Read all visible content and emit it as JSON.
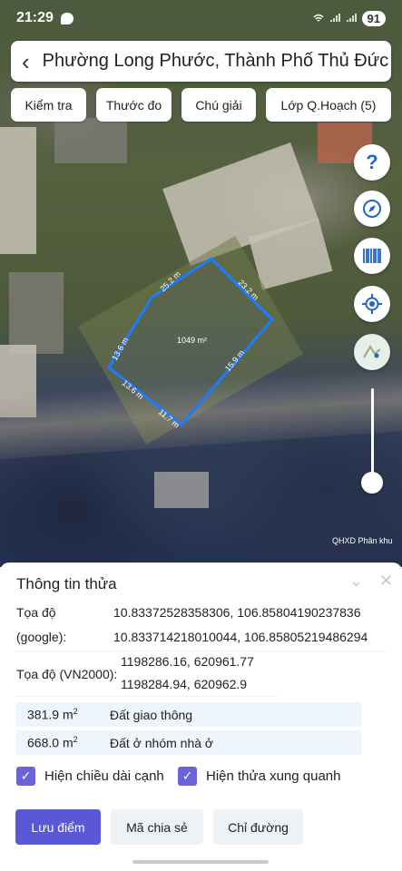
{
  "status_bar": {
    "time": "21:29",
    "battery": "91"
  },
  "search": {
    "back_icon": "chevron-left-icon",
    "title": "Phường Long Phước, Thành Phố Thủ Đức"
  },
  "chips": [
    {
      "label": "Kiểm tra"
    },
    {
      "label": "Thước đo"
    },
    {
      "label": "Chú giải"
    },
    {
      "label": "Lớp Q.Hoạch (5)"
    }
  ],
  "map_tools": [
    {
      "icon": "help-icon",
      "glyph": "?"
    },
    {
      "icon": "compass-icon",
      "glyph": "⊘"
    },
    {
      "icon": "barcode-icon",
      "glyph": "||||"
    },
    {
      "icon": "locate-icon",
      "glyph": "◎"
    },
    {
      "icon": "map-layer-icon",
      "glyph": "◈"
    }
  ],
  "parcel": {
    "area": "1049 m²",
    "edges": [
      "25.2 m",
      "23.2 m",
      "13.6 m",
      "13.6 m",
      "15.9 m",
      "11.7 m"
    ]
  },
  "map_label": "QHXD Phân khu",
  "sheet": {
    "title": "Thông tin thửa",
    "google_label_1": "Tọa độ",
    "google_label_2": "(google):",
    "google_values": [
      "10.83372528358306, 106.85804190237836",
      "10.833714218010044, 106.85805219486294"
    ],
    "vn2000_label": "Tọa độ (VN2000):",
    "vn2000_values": [
      "1198286.16, 620961.77",
      "1198284.94, 620962.9"
    ],
    "land_uses": [
      {
        "area": "381.9",
        "unit": "m",
        "type": "Đất giao thông"
      },
      {
        "area": "668.0",
        "unit": "m",
        "type": "Đất ở nhóm nhà ở"
      }
    ],
    "check_edges": "Hiện chiều dài cạnh",
    "check_neighbors": "Hiện thửa xung quanh",
    "btn_save": "Lưu điểm",
    "btn_share": "Mã chia sẻ",
    "btn_direction": "Chỉ đường"
  }
}
